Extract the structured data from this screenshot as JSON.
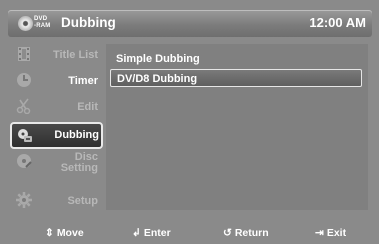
{
  "header": {
    "disc_badge_line1": "DVD",
    "disc_badge_line2": "-RAM",
    "title": "Dubbing",
    "clock": "12:00 AM"
  },
  "sidebar": {
    "items": [
      {
        "label": "Title List",
        "icon": "film-icon",
        "active": false
      },
      {
        "label": "Timer",
        "icon": "clock-icon",
        "active": false
      },
      {
        "label": "Edit",
        "icon": "scissors-icon",
        "active": false
      },
      {
        "label": "Dubbing",
        "icon": "dubbing-icon",
        "active": true
      },
      {
        "label_line1": "Disc",
        "label_line2": "Setting",
        "icon": "disc-setting-icon",
        "active": false
      },
      {
        "label": "Setup",
        "icon": "gear-icon",
        "active": false
      }
    ]
  },
  "options": [
    {
      "label": "Simple Dubbing",
      "selected": false
    },
    {
      "label": "DV/D8 Dubbing",
      "selected": true
    }
  ],
  "footer": {
    "move": "Move",
    "enter": "Enter",
    "return": "Return",
    "exit": "Exit"
  }
}
